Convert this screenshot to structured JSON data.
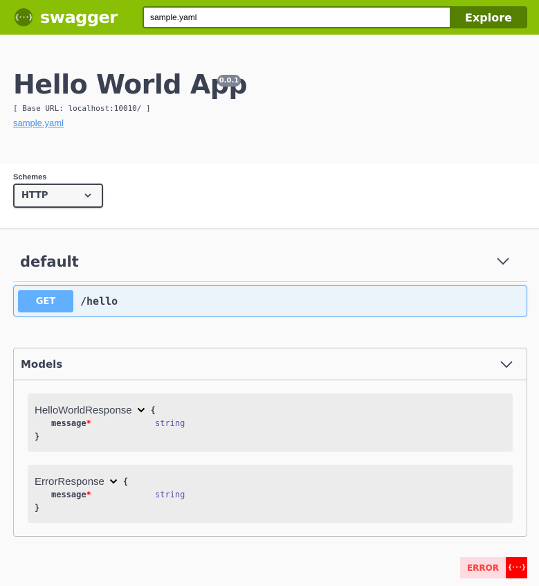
{
  "topbar": {
    "logo_glyph": "{···}",
    "brand": "swagger",
    "url_value": "sample.yaml",
    "explore_label": "Explore",
    "colors": {
      "bar": "#89bf04",
      "dark": "#547f00"
    }
  },
  "info": {
    "title": "Hello World App",
    "version": "0.0.1",
    "base_url": "[ Base URL: localhost:10010/ ]",
    "spec_link": "sample.yaml"
  },
  "schemes": {
    "label": "Schemes",
    "selected": "HTTP"
  },
  "tag": {
    "name": "default",
    "operations": [
      {
        "method": "GET",
        "path": "/hello",
        "color": "#61affe"
      }
    ]
  },
  "models": {
    "title": "Models",
    "items": [
      {
        "name": "HelloWorldResponse",
        "open_brace": "{",
        "close_brace": "}",
        "properties": [
          {
            "name": "message",
            "required_mark": "*",
            "type": "string"
          }
        ]
      },
      {
        "name": "ErrorResponse",
        "open_brace": "{",
        "close_brace": "}",
        "properties": [
          {
            "name": "message",
            "required_mark": "*",
            "type": "string"
          }
        ]
      }
    ]
  },
  "validator": {
    "status": "ERROR",
    "icon_glyph": "{···}"
  }
}
